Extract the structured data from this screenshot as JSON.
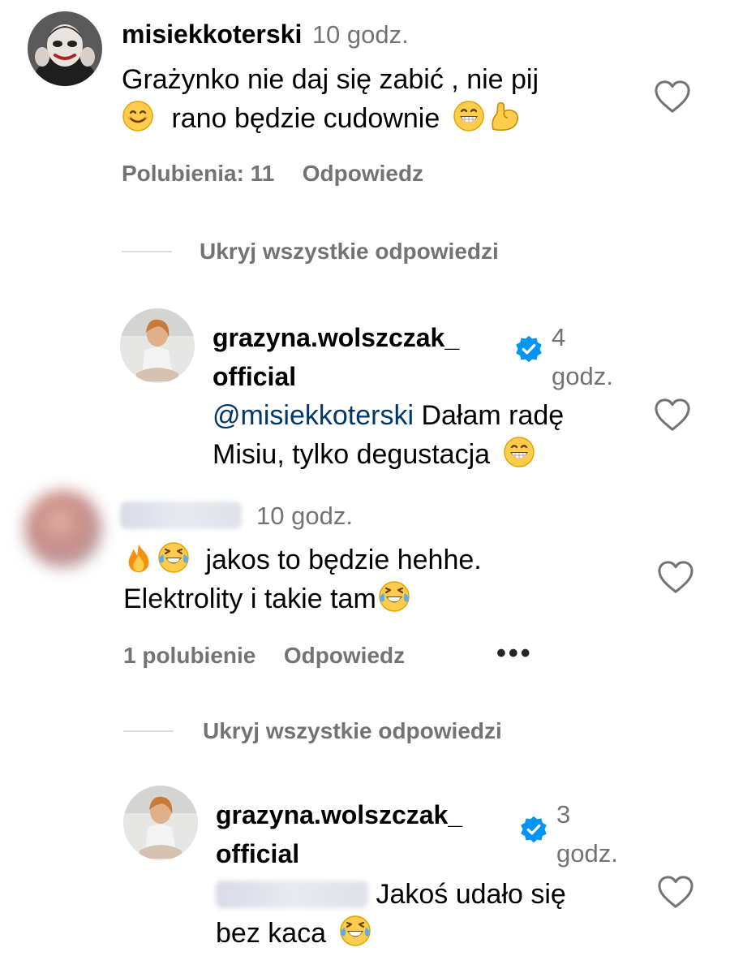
{
  "comments": [
    {
      "username": "misiekkoterski",
      "time": "10 godz.",
      "text_line1": "Grażynko nie daj się zabić , nie pij",
      "text_line2": "rano będzie cudownie",
      "likes": "Polubienia: 11",
      "reply": "Odpowiedz",
      "hide_replies": "Ukryj wszystkie odpowiedzi",
      "reply_item": {
        "username_line1": "grazyna.wolszczak_",
        "username_line2": "official",
        "time_line1": "4",
        "time_line2": "godz.",
        "mention": "@misiekkoterski",
        "text_line1": "Dałam radę",
        "text_line2": "Misiu, tylko degustacja"
      }
    },
    {
      "time": "10 godz.",
      "text_line1": "jakos to będzie hehhe.",
      "text_line2": "Elektrolity i takie tam",
      "likes": "1 polubienie",
      "reply": "Odpowiedz",
      "more": "•••",
      "hide_replies": "Ukryj wszystkie odpowiedzi",
      "reply_item": {
        "username_line1": "grazyna.wolszczak_",
        "username_line2": "official",
        "time_line1": "3",
        "time_line2": "godz.",
        "text_line1": "Jakoś udało się",
        "text_line2": "bez kaca"
      }
    }
  ],
  "icons": {
    "heart": "heart-outline-icon",
    "verified": "verified-badge-icon",
    "emoji_smile": "smiling-face-icon",
    "emoji_grin": "grinning-face-icon",
    "emoji_muscle": "flexed-biceps-icon",
    "emoji_fire": "fire-icon",
    "emoji_laugh": "tears-of-joy-icon"
  },
  "colors": {
    "secondary_text": "#737373",
    "verified_blue": "#0095f6",
    "link": "#00376b",
    "divider": "#dbdbdb"
  }
}
